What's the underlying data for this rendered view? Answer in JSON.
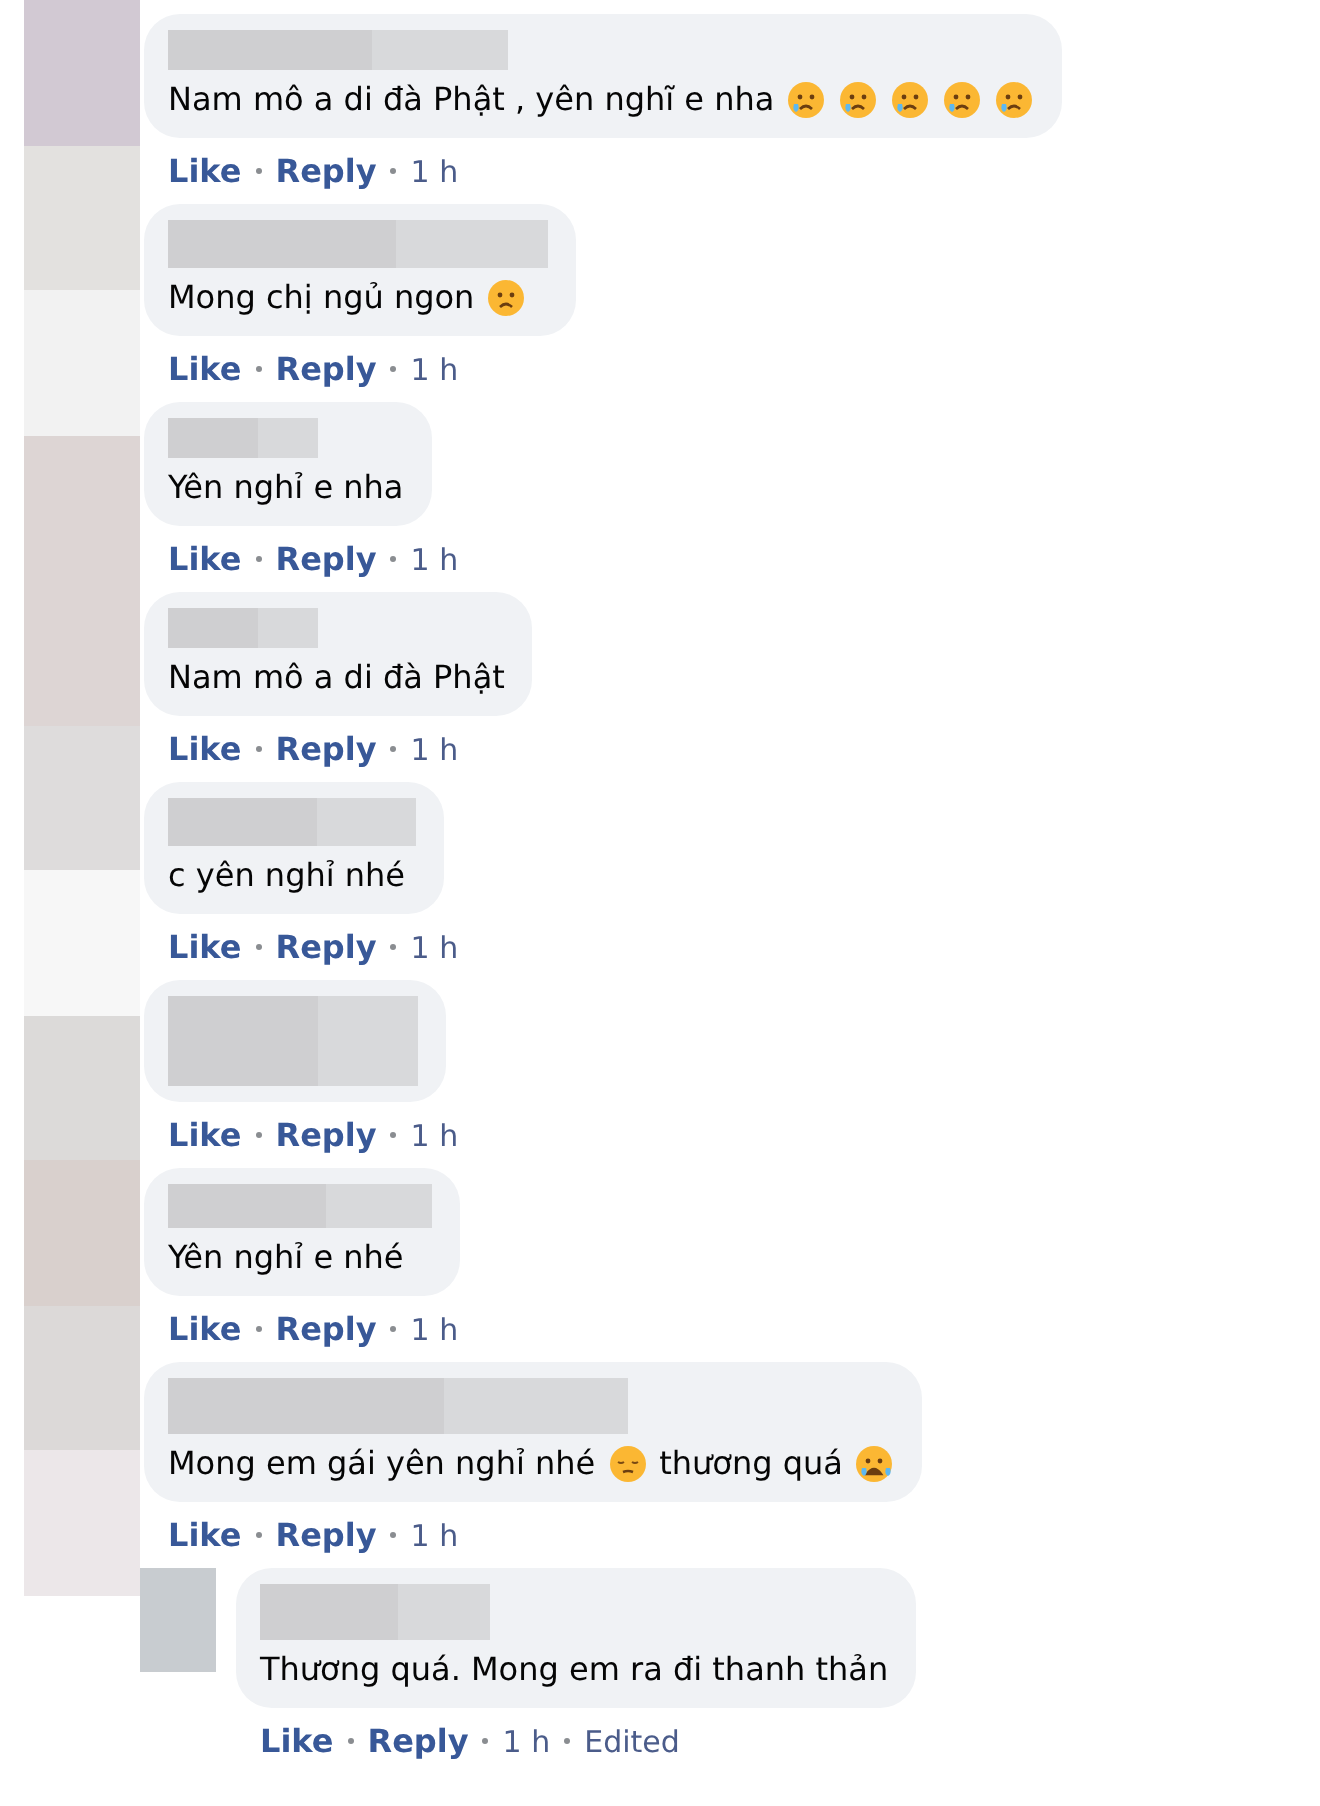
{
  "comments": [
    {
      "text": "Nam mô a di đà Phật , yên nghĩ e nha",
      "emojis": [
        {
          "kind": "sad-tear"
        },
        {
          "kind": "sad-tear"
        },
        {
          "kind": "sad-tear"
        },
        {
          "kind": "sad-tear"
        },
        {
          "kind": "sad-tear"
        }
      ],
      "actions": {
        "like": "Like",
        "reply": "Reply",
        "time": "1 h"
      }
    },
    {
      "text": "Mong chị ngủ ngon",
      "emojis": [
        {
          "kind": "frown"
        }
      ],
      "actions": {
        "like": "Like",
        "reply": "Reply",
        "time": "1 h"
      }
    },
    {
      "text": "Yên nghỉ e nha",
      "actions": {
        "like": "Like",
        "reply": "Reply",
        "time": "1 h"
      }
    },
    {
      "text": "Nam mô a di đà Phật",
      "actions": {
        "like": "Like",
        "reply": "Reply",
        "time": "1 h"
      }
    },
    {
      "text": "c yên nghỉ nhé",
      "actions": {
        "like": "Like",
        "reply": "Reply",
        "time": "1 h"
      }
    },
    {
      "actions": {
        "like": "Like",
        "reply": "Reply",
        "time": "1 h"
      }
    },
    {
      "text": "Yên nghỉ e nhé",
      "actions": {
        "like": "Like",
        "reply": "Reply",
        "time": "1 h"
      }
    },
    {
      "text": "Mong em gái yên nghỉ nhé",
      "emojis": [
        {
          "kind": "pensive"
        }
      ],
      "text_after": "thương quá",
      "emojis_after": [
        {
          "kind": "crying"
        }
      ],
      "actions": {
        "like": "Like",
        "reply": "Reply",
        "time": "1 h"
      },
      "replies": [
        {
          "text": "Thương quá. Mong em ra đi thanh thản",
          "actions": {
            "like": "Like",
            "reply": "Reply",
            "time": "1 h",
            "edited": "Edited"
          }
        }
      ]
    }
  ]
}
